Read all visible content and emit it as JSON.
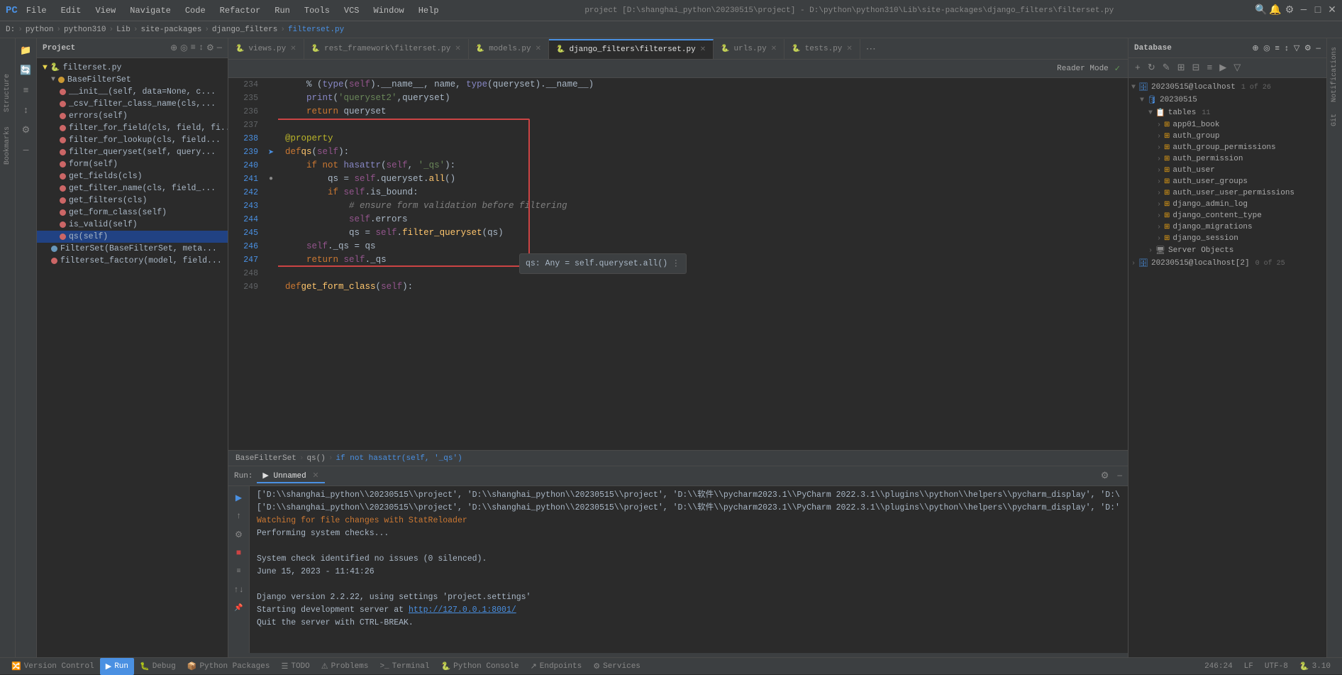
{
  "window": {
    "title": "project [D:\\shanghai_python\\20230515\\project] - D:\\python\\python310\\Lib\\site-packages\\django_filters\\filterset.py",
    "app_icon": "PC",
    "min_label": "─",
    "max_label": "□",
    "close_label": "✕"
  },
  "menu": {
    "items": [
      "File",
      "Edit",
      "View",
      "Navigate",
      "Code",
      "Refactor",
      "Run",
      "Tools",
      "VCS",
      "Window",
      "Help"
    ]
  },
  "breadcrumb": {
    "items": [
      "D:",
      "python",
      "python310",
      "Lib",
      "site-packages",
      "django_filters",
      "filterset.py"
    ]
  },
  "project_panel": {
    "title": "Project",
    "root": "filterset.py",
    "items": [
      {
        "indent": 16,
        "type": "class",
        "name": "BaseFilterSet",
        "color": "orange"
      },
      {
        "indent": 24,
        "type": "method",
        "name": "__init__(self, data=None, c...",
        "color": "red"
      },
      {
        "indent": 24,
        "type": "method",
        "name": "_csv_filter_class_name(cls,...",
        "color": "red"
      },
      {
        "indent": 24,
        "type": "method",
        "name": "errors(self)",
        "color": "red"
      },
      {
        "indent": 24,
        "type": "method",
        "name": "filter_for_field(cls, field, fi...",
        "color": "red"
      },
      {
        "indent": 24,
        "type": "method",
        "name": "filter_for_lookup(cls, field...",
        "color": "red"
      },
      {
        "indent": 24,
        "type": "method",
        "name": "filter_queryset(self, query...",
        "color": "red"
      },
      {
        "indent": 24,
        "type": "method",
        "name": "form(self)",
        "color": "red"
      },
      {
        "indent": 24,
        "type": "method",
        "name": "get_fields(cls)",
        "color": "red"
      },
      {
        "indent": 24,
        "type": "method",
        "name": "get_filter_name(cls, field_...",
        "color": "red"
      },
      {
        "indent": 24,
        "type": "method",
        "name": "get_filters(cls)",
        "color": "red"
      },
      {
        "indent": 24,
        "type": "method",
        "name": "get_form_class(self)",
        "color": "red"
      },
      {
        "indent": 24,
        "type": "method",
        "name": "is_valid(self)",
        "color": "red"
      },
      {
        "indent": 24,
        "type": "method",
        "name": "qs(self)",
        "color": "red"
      },
      {
        "indent": 16,
        "type": "class",
        "name": "FilterSet(BaseFilterSet, meta...",
        "color": "blue"
      },
      {
        "indent": 16,
        "type": "function",
        "name": "filterset_factory(model, field...",
        "color": "red"
      }
    ]
  },
  "tabs": [
    {
      "name": "views.py",
      "icon": "py",
      "active": false,
      "closeable": true
    },
    {
      "name": "rest_framework\\filterset.py",
      "icon": "py",
      "active": false,
      "closeable": true
    },
    {
      "name": "models.py",
      "icon": "py",
      "active": false,
      "closeable": true
    },
    {
      "name": "django_filters\\filterset.py",
      "icon": "py",
      "active": true,
      "closeable": true
    },
    {
      "name": "urls.py",
      "icon": "py",
      "active": false,
      "closeable": true
    },
    {
      "name": "tests.py",
      "icon": "py",
      "active": false,
      "closeable": true
    }
  ],
  "reader_mode": {
    "label": "Reader Mode",
    "check": "✓"
  },
  "code": {
    "lines": [
      {
        "num": 234,
        "content": "    % (type(self).__name__, name, type(queryset).__name__)"
      },
      {
        "num": 235,
        "content": "    print('queryset2',queryset)"
      },
      {
        "num": 236,
        "content": "    return queryset"
      },
      {
        "num": 237,
        "content": ""
      },
      {
        "num": 238,
        "content": "@property"
      },
      {
        "num": 239,
        "content": "def qs(self):"
      },
      {
        "num": 240,
        "content": "    if not hasattr(self, '_qs'):"
      },
      {
        "num": 241,
        "content": "        qs = self.queryset.all()"
      },
      {
        "num": 242,
        "content": "        if self.is_bound:"
      },
      {
        "num": 243,
        "content": "            # ensure form validation before filtering"
      },
      {
        "num": 244,
        "content": "            self.errors"
      },
      {
        "num": 245,
        "content": "            qs = self.filter_queryset(qs)"
      },
      {
        "num": 246,
        "content": "    self._qs = qs"
      },
      {
        "num": 247,
        "content": "    return self._qs"
      },
      {
        "num": 248,
        "content": ""
      },
      {
        "num": 249,
        "content": "def get_form_class(self):"
      }
    ],
    "tooltip": {
      "text": "qs: Any = self.queryset.all()",
      "prefix": "qs:"
    }
  },
  "editor_breadcrumb": {
    "items": [
      "BaseFilterSet",
      "qs()",
      "if not hasattr(self, '_qs')"
    ]
  },
  "database": {
    "title": "Database",
    "connections": [
      {
        "name": "20230515@localhost",
        "badge": "1 of 26",
        "children": [
          {
            "name": "20230515",
            "children": [
              {
                "name": "tables",
                "badge": "11",
                "children": [
                  "app01_book",
                  "auth_group",
                  "auth_group_permissions",
                  "auth_permission",
                  "auth_user",
                  "auth_user_groups",
                  "auth_user_user_permissions",
                  "django_admin_log",
                  "django_content_type",
                  "django_migrations",
                  "django_session"
                ]
              },
              {
                "name": "Server Objects"
              }
            ]
          },
          {
            "name": "20230515@localhost[2]",
            "badge": "0 of 25"
          }
        ]
      }
    ]
  },
  "run_panel": {
    "tab_label": "Unnamed",
    "run_icon": "▶",
    "output_lines": [
      {
        "type": "normal",
        "text": "['D:\\\\shanghai_python\\\\20230515\\\\project', 'D:\\\\shanghai_python\\\\20230515\\\\project', 'D:\\\\软件\\\\pycharm2023.1\\\\PyCharm 2022.3.1\\\\plugins\\\\python\\\\helpers\\\\pycharm_display', 'D:\\"
      },
      {
        "type": "normal",
        "text": "['D:\\\\shanghai_python\\\\20230515\\\\project', 'D:\\\\shanghai_python\\\\20230515\\\\project', 'D:\\\\软件\\\\pycharm2023.1\\\\PyCharm 2022.3.1\\\\plugins\\\\python\\\\helpers\\\\pycharm_display', 'D:\\'"
      },
      {
        "type": "watching",
        "text": "Watching for file changes with StatReloader"
      },
      {
        "type": "normal",
        "text": "Performing system checks..."
      },
      {
        "type": "normal",
        "text": ""
      },
      {
        "type": "normal",
        "text": "System check identified no issues (0 silenced)."
      },
      {
        "type": "normal",
        "text": "June 15, 2023 - 11:41:26"
      },
      {
        "type": "normal",
        "text": ""
      },
      {
        "type": "normal",
        "text": "Django version 2.2.22, using settings 'project.settings'"
      },
      {
        "type": "normal",
        "text": "Starting development server at "
      },
      {
        "type": "link",
        "text": "http://127.0.0.1:8001/"
      },
      {
        "type": "normal",
        "text": "Quit the server with CTRL-BREAK."
      }
    ]
  },
  "status_bar": {
    "items_left": [
      {
        "name": "version-control",
        "label": "Version Control",
        "icon": "🔀"
      },
      {
        "name": "run",
        "label": "Run",
        "icon": "▶",
        "active": true
      },
      {
        "name": "debug",
        "label": "Debug",
        "icon": "🐛"
      },
      {
        "name": "python-packages",
        "label": "Python Packages",
        "icon": "📦"
      },
      {
        "name": "todo",
        "label": "TODO",
        "icon": "☰"
      },
      {
        "name": "problems",
        "label": "Problems",
        "icon": "⚠"
      },
      {
        "name": "terminal",
        "label": "Terminal",
        "icon": ">"
      },
      {
        "name": "python-console",
        "label": "Python Console",
        "icon": "🐍"
      },
      {
        "name": "endpoints",
        "label": "Endpoints",
        "icon": "↗"
      },
      {
        "name": "services",
        "label": "Services",
        "icon": "⚙"
      }
    ],
    "items_right": [
      {
        "name": "cursor-pos",
        "label": "246:24"
      },
      {
        "name": "line-ending",
        "label": "LF"
      },
      {
        "name": "encoding",
        "label": "UTF-8"
      },
      {
        "name": "python-version",
        "label": "3.10"
      }
    ]
  },
  "left_vtabs": [
    "Structure",
    "Bookmarks"
  ],
  "right_vtabs": [
    "Notifications",
    "Git"
  ]
}
